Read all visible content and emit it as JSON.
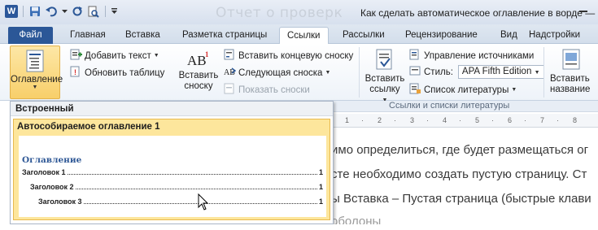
{
  "window": {
    "title_ghost": "Отчет о проверк",
    "title": "Как сделать автоматическое оглавление в ворде —"
  },
  "qat": {
    "icons": [
      "word-logo",
      "save-icon",
      "undo-icon",
      "dropdown-arrow",
      "redo-icon",
      "print-preview-icon",
      "customize-icon"
    ],
    "word_letter": "W"
  },
  "tabs": [
    "Файл",
    "Главная",
    "Вставка",
    "Разметка страницы",
    "Ссылки",
    "Рассылки",
    "Рецензирование",
    "Вид",
    "Надстройки"
  ],
  "active_tab": "Ссылки",
  "ribbon": {
    "toc_button": "Оглавление",
    "add_text": "Добавить текст",
    "update_table": "Обновить таблицу",
    "insert_footnote": "Вставить\nсноску",
    "insert_endnote": "Вставить концевую сноску",
    "next_footnote": "Следующая сноска",
    "show_notes": "Показать сноски",
    "insert_citation": "Вставить\nссылку",
    "manage_sources": "Управление источниками",
    "style_label": "Стиль:",
    "style_value": "APA Fifth Edition",
    "bibliography": "Список литературы",
    "citations_group": "Ссылки и списки литературы",
    "insert_caption": "Вставить\nназвание"
  },
  "gallery": {
    "header": "Встроенный",
    "item_title": "Автособираемое оглавление 1",
    "preview": {
      "heading": "Оглавление",
      "entries": [
        {
          "text": "Заголовок 1",
          "page": "1"
        },
        {
          "text": "Заголовок 2",
          "page": "1"
        },
        {
          "text": "Заголовок 3",
          "page": "1"
        }
      ]
    }
  },
  "document": {
    "lines": [
      "имо определиться, где будет размещаться ог",
      "сте необходимо создать пустую страницу. Ст",
      "ы Вставка – Пустая страница (быстрые клави",
      "оболоны"
    ]
  },
  "colors": {
    "file_tab": "#2b5797",
    "toc_highlight": "#fde69c",
    "toc_heading": "#2f5896"
  }
}
